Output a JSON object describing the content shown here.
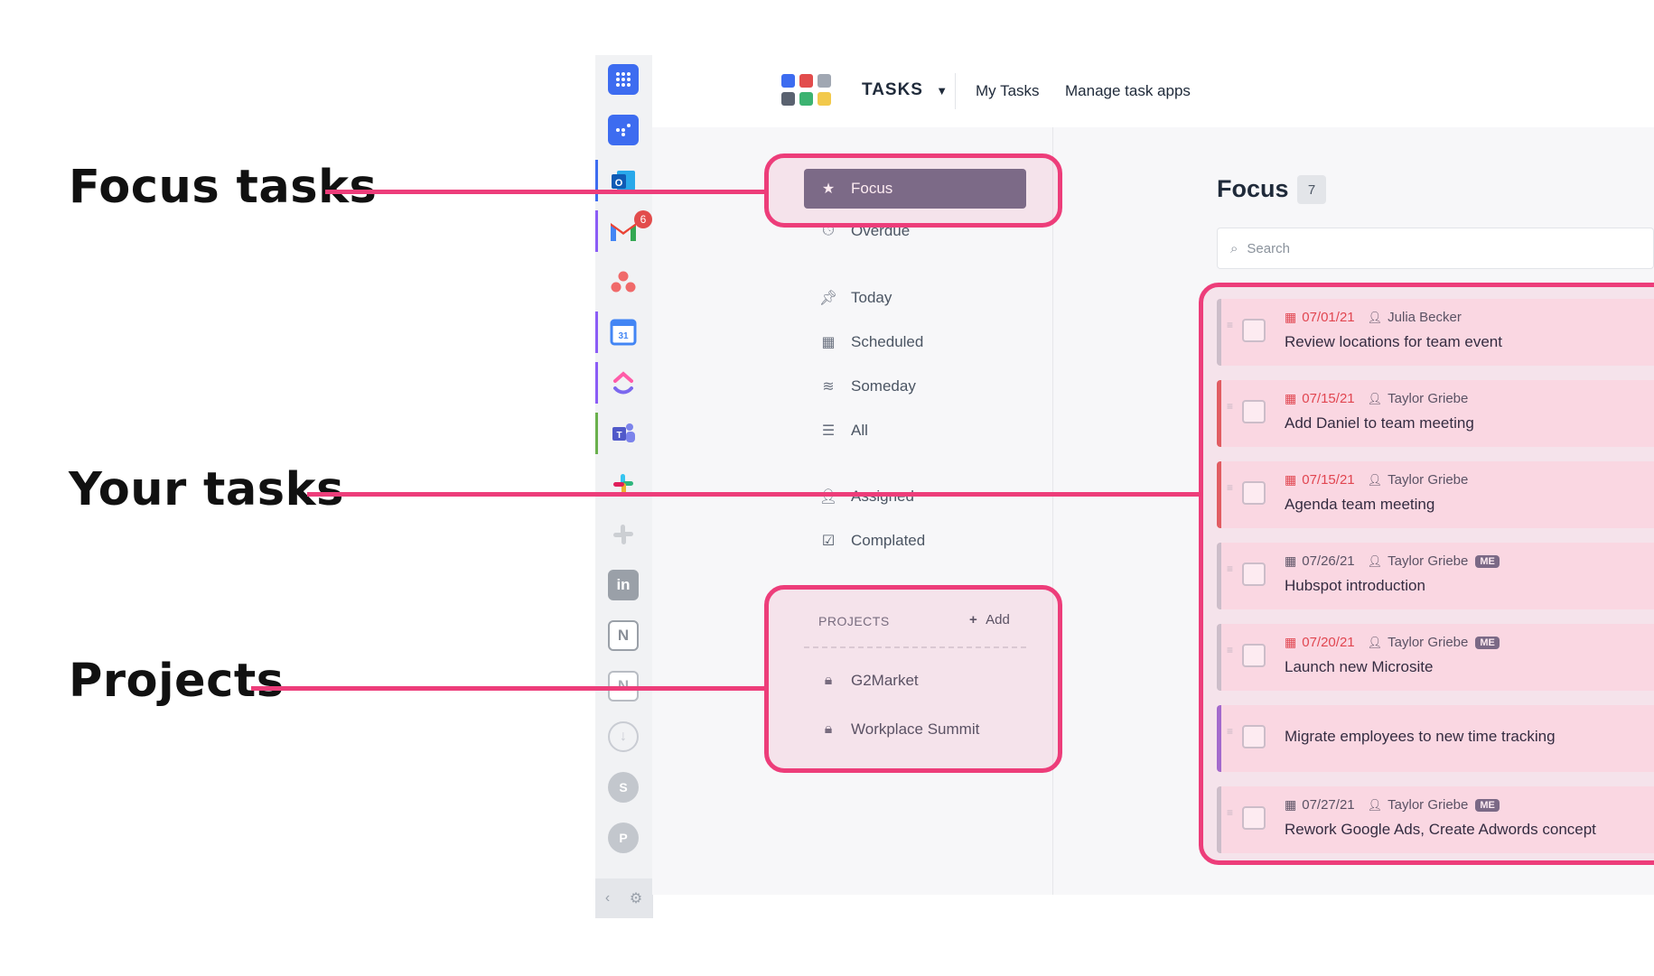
{
  "annotations": {
    "focus_tasks": "Focus tasks",
    "your_tasks": "Your tasks",
    "projects": "Projects",
    "accent_color": "#ed3d7a"
  },
  "rail": {
    "apps": [
      {
        "name": "app-launcher",
        "icon": "grid-icon"
      },
      {
        "name": "tasks-app",
        "icon": "tasks-app-icon"
      },
      {
        "name": "outlook",
        "icon": "outlook-icon"
      },
      {
        "name": "gmail",
        "icon": "gmail-icon",
        "badge": "6"
      },
      {
        "name": "asana",
        "icon": "asana-icon"
      },
      {
        "name": "google-calendar",
        "icon": "calendar-icon",
        "label": "31"
      },
      {
        "name": "clickup",
        "icon": "clickup-icon"
      },
      {
        "name": "teams",
        "icon": "teams-icon"
      },
      {
        "name": "slack",
        "icon": "slack-icon"
      },
      {
        "name": "slack-inactive",
        "icon": "slack-icon"
      },
      {
        "name": "linkedin",
        "icon": "linkedin-icon",
        "label": "in"
      },
      {
        "name": "notion",
        "icon": "notion-icon",
        "label": "N"
      },
      {
        "name": "notion-2",
        "icon": "notion-icon",
        "label": "N"
      },
      {
        "name": "download",
        "icon": "download-icon"
      },
      {
        "name": "sharepoint",
        "icon": "sharepoint-icon",
        "label": "S"
      },
      {
        "name": "powerpoint",
        "icon": "powerpoint-icon",
        "label": "P"
      }
    ],
    "collapse_icon": "chevron-left-icon",
    "settings_icon": "gear-icon"
  },
  "header": {
    "app_title": "TASKS",
    "dropdown_glyph": "▼",
    "links": [
      "My Tasks",
      "Manage task apps"
    ]
  },
  "nav": {
    "focus": "Focus",
    "overdue": "Overdue",
    "today": "Today",
    "scheduled": "Scheduled",
    "someday": "Someday",
    "all": "All",
    "assigned": "Assigned",
    "completed": "Complated"
  },
  "projects": {
    "heading": "PROJECTS",
    "add_label": "Add",
    "items": [
      "G2Market",
      "Workplace Summit"
    ]
  },
  "main": {
    "title": "Focus",
    "count": "7",
    "search_placeholder": "Search"
  },
  "tasks": [
    {
      "date": "07/01/21",
      "overdue": true,
      "person": "Julia Becker",
      "me": "",
      "title": "Review locations for team event",
      "bar_color": "#c9ccd3"
    },
    {
      "date": "07/15/21",
      "overdue": true,
      "person": "Taylor Griebe",
      "me": "",
      "title": "Add Daniel to team meeting",
      "bar_color": "#e06060"
    },
    {
      "date": "07/15/21",
      "overdue": true,
      "person": "Taylor Griebe",
      "me": "",
      "title": "Agenda team meeting",
      "bar_color": "#e06060"
    },
    {
      "date": "07/26/21",
      "overdue": false,
      "person": "Taylor Griebe",
      "me": "ME",
      "title": "Hubspot introduction",
      "bar_color": "#c9ccd3"
    },
    {
      "date": "07/20/21",
      "overdue": true,
      "person": "Taylor Griebe",
      "me": "ME",
      "title": "Launch new Microsite",
      "bar_color": "#c9ccd3"
    },
    {
      "date": "",
      "overdue": false,
      "person": "",
      "me": "",
      "title": "Migrate employees to new time tracking",
      "bar_color": "#9b6fd6"
    },
    {
      "date": "07/27/21",
      "overdue": false,
      "person": "Taylor Griebe",
      "me": "ME",
      "title": "Rework Google Ads, Create Adwords concept",
      "bar_color": "#c9ccd3"
    }
  ]
}
